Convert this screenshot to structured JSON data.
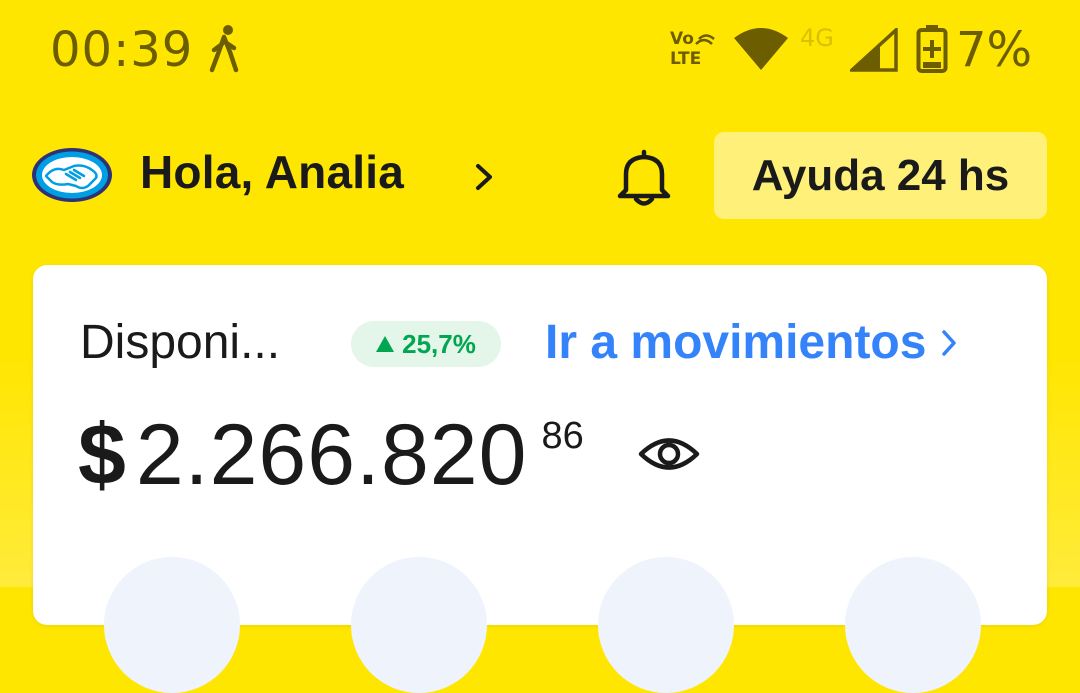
{
  "status_bar": {
    "time": "00:39",
    "volte_top": "Vo",
    "volte_bottom": "LTE",
    "network": "4G",
    "battery": "7%",
    "icons": [
      "walk-icon",
      "volte-icon",
      "wifi-icon",
      "signal-icon",
      "battery-charging-icon"
    ]
  },
  "header": {
    "greeting": "Hola, Analia",
    "help_label": "Ayuda 24 hs",
    "icons": [
      "mercadopago-logo",
      "chevron-right-icon",
      "bell-icon"
    ]
  },
  "balance_card": {
    "label": "Disponi...",
    "trend_value": "25,7%",
    "trend_direction": "up",
    "movements_link": "Ir a movimientos",
    "currency_symbol": "$",
    "amount_integer": "2.266.820",
    "amount_cents": "86",
    "icons": [
      "eye-icon",
      "chevron-right-icon"
    ]
  },
  "colors": {
    "brand_yellow": "#FFE600",
    "link_blue": "#3483FA",
    "trend_green": "#00A650",
    "status_text": "#6b5d00"
  }
}
